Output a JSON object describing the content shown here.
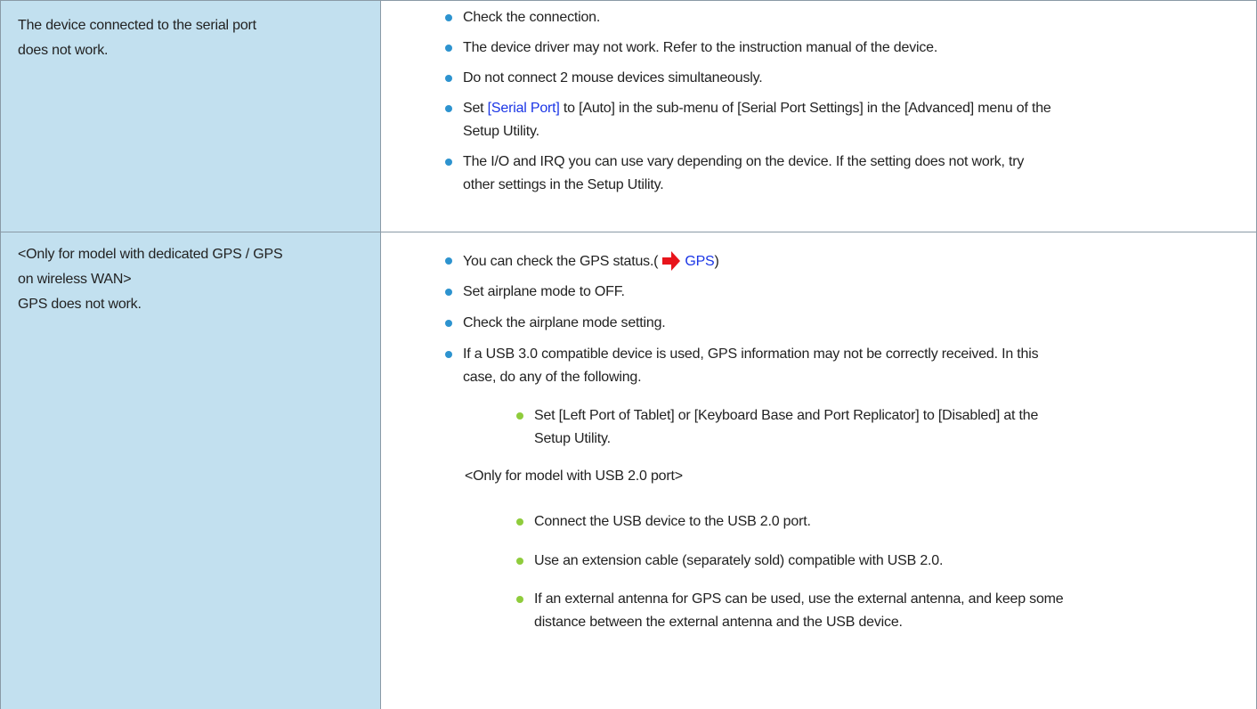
{
  "rows": [
    {
      "problem": "The device connected to the serial port\ndoes not work.",
      "items": [
        {
          "text": "Check the connection."
        },
        {
          "text": "The device driver may not work. Refer to the instruction manual of the device."
        },
        {
          "text": "Do not connect 2 mouse devices simultaneously."
        },
        {
          "prefix": "Set ",
          "link": "[Serial Port]",
          "suffix_line1": " to [Auto] in the sub-menu of [Serial Port Settings] in the [Advanced] menu of the",
          "line2": "Setup Utility."
        },
        {
          "line1": "The I/O and IRQ you can use vary depending on the device. If the setting does not work, try",
          "line2": "other settings in the Setup Utility."
        }
      ]
    },
    {
      "problem": "<Only for model with dedicated GPS / GPS\non wireless WAN>\n GPS does not work.",
      "items": [
        {
          "prefix": "You can check the GPS status.(",
          "link": "GPS",
          "suffix": ")"
        },
        {
          "text": "Set airplane mode to OFF."
        },
        {
          "text": "Check the airplane mode setting."
        },
        {
          "line1": "If a USB 3.0 compatible device is used, GPS information may not be correctly received. In this",
          "line2": "case, do any of the following."
        }
      ],
      "sub_items_a": [
        {
          "line1": "Set [Left Port of Tablet] or [Keyboard Base and Port Replicator] to [Disabled] at the",
          "line2": "Setup Utility."
        }
      ],
      "note": "<Only for model with USB 2.0 port>",
      "sub_items_b": [
        {
          "text": "Connect the USB device to the USB 2.0 port."
        },
        {
          "text": "Use an extension cable (separately sold) compatible with USB 2.0."
        },
        {
          "line1": "If an external antenna for GPS can be used, use the external antenna, and keep some",
          "line2": "distance between the external antenna and the USB device."
        }
      ]
    }
  ],
  "colors": {
    "problem_bg": "#c2e0ef",
    "bullet": "#2d93cf",
    "sub_bullet": "#8fcc3c",
    "link": "#1a35e6",
    "arrow": "#e8141b"
  },
  "icons": {
    "reference_arrow": "red-arrow-icon"
  }
}
